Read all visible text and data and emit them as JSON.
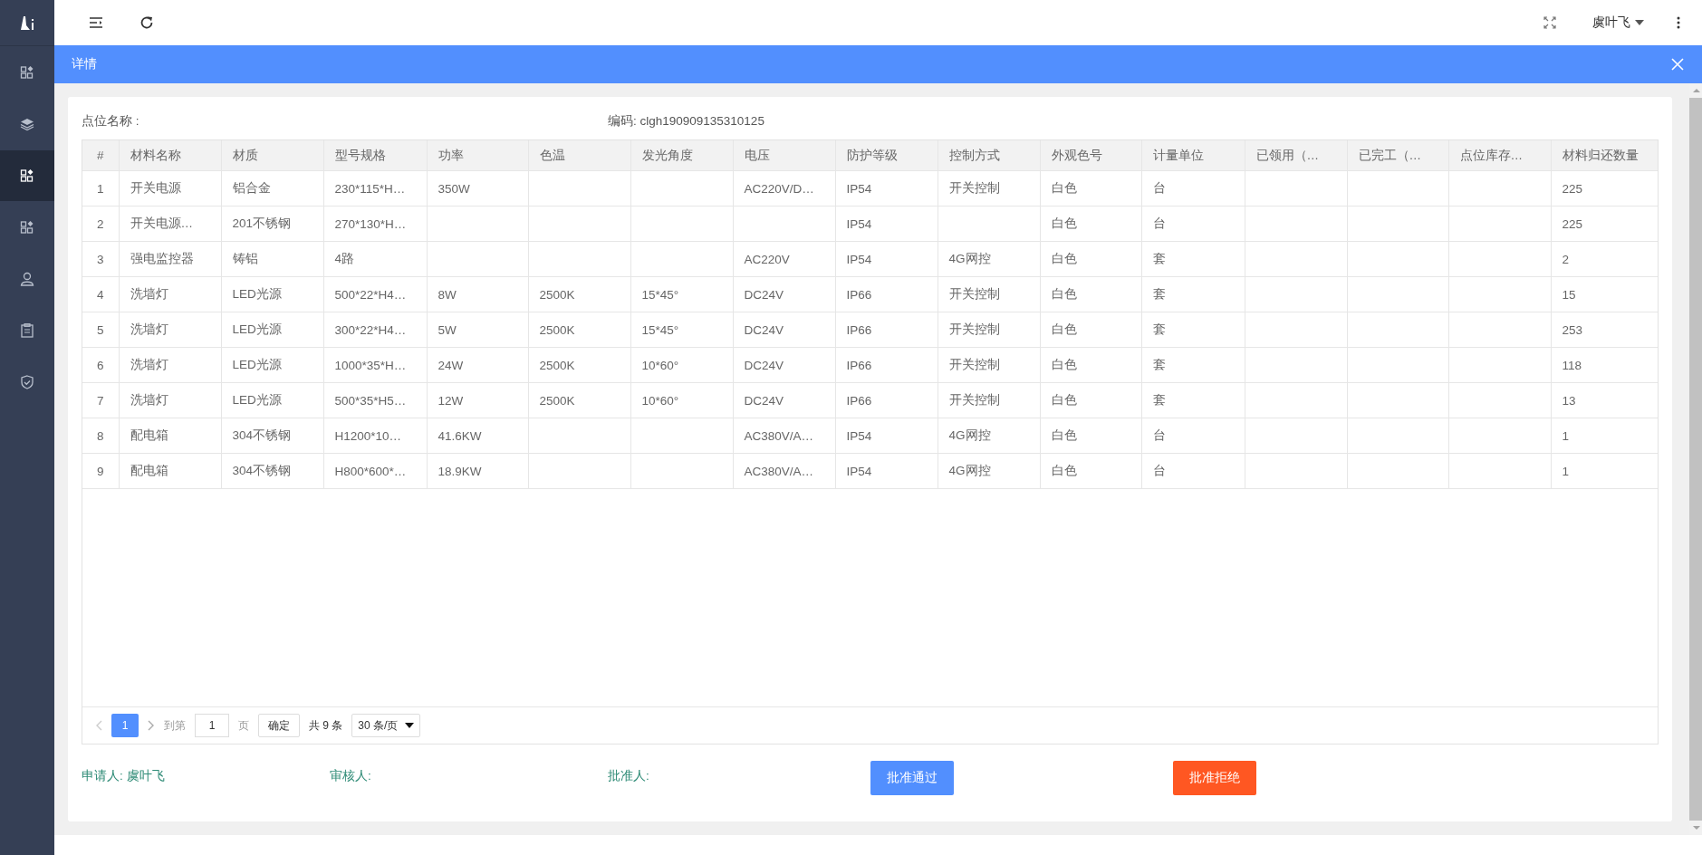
{
  "sidebar": {
    "items": [
      {
        "selected": false
      },
      {
        "selected": false
      },
      {
        "selected": true
      },
      {
        "selected": false
      },
      {
        "selected": false
      },
      {
        "selected": false
      },
      {
        "selected": false
      }
    ]
  },
  "topbar": {
    "user": "虞叶飞"
  },
  "dialog": {
    "title": "详情",
    "point_name_label": "点位名称 :",
    "code": "编码: clgh190909135310125"
  },
  "table": {
    "columns": [
      "#",
      "材料名称",
      "材质",
      "型号规格",
      "功率",
      "色温",
      "发光角度",
      "电压",
      "防护等级",
      "控制方式",
      "外观色号",
      "计量单位",
      "已领用（…",
      "已完工（…",
      "点位库存…",
      "材料归还数量"
    ],
    "rows": [
      [
        "1",
        "开关电源",
        "铝合金",
        "230*115*H…",
        "350W",
        "",
        "",
        "AC220V/D…",
        "IP54",
        "开关控制",
        "白色",
        "台",
        "",
        "",
        "",
        "225"
      ],
      [
        "2",
        "开关电源…",
        "201不锈钢",
        "270*130*H…",
        "",
        "",
        "",
        "",
        "IP54",
        "",
        "白色",
        "台",
        "",
        "",
        "",
        "225"
      ],
      [
        "3",
        "强电监控器",
        "铸铝",
        "4路",
        "",
        "",
        "",
        "AC220V",
        "IP54",
        "4G网控",
        "白色",
        "套",
        "",
        "",
        "",
        "2"
      ],
      [
        "4",
        "洗墙灯",
        "LED光源",
        "500*22*H4…",
        "8W",
        "2500K",
        "15*45°",
        "DC24V",
        "IP66",
        "开关控制",
        "白色",
        "套",
        "",
        "",
        "",
        "15"
      ],
      [
        "5",
        "洗墙灯",
        "LED光源",
        "300*22*H4…",
        "5W",
        "2500K",
        "15*45°",
        "DC24V",
        "IP66",
        "开关控制",
        "白色",
        "套",
        "",
        "",
        "",
        "253"
      ],
      [
        "6",
        "洗墙灯",
        "LED光源",
        "1000*35*H…",
        "24W",
        "2500K",
        "10*60°",
        "DC24V",
        "IP66",
        "开关控制",
        "白色",
        "套",
        "",
        "",
        "",
        "118"
      ],
      [
        "7",
        "洗墙灯",
        "LED光源",
        "500*35*H5…",
        "12W",
        "2500K",
        "10*60°",
        "DC24V",
        "IP66",
        "开关控制",
        "白色",
        "套",
        "",
        "",
        "",
        "13"
      ],
      [
        "8",
        "配电箱",
        "304不锈钢",
        "H1200*10…",
        "41.6KW",
        "",
        "",
        "AC380V/A…",
        "IP54",
        "4G网控",
        "白色",
        "台",
        "",
        "",
        "",
        "1"
      ],
      [
        "9",
        "配电箱",
        "304不锈钢",
        "H800*600*…",
        "18.9KW",
        "",
        "",
        "AC380V/A…",
        "IP54",
        "4G网控",
        "白色",
        "台",
        "",
        "",
        "",
        "1"
      ]
    ]
  },
  "pagination": {
    "pages": [
      {
        "label": "1",
        "selected": true
      }
    ],
    "goto_label": "到第",
    "goto_value": "1",
    "page_unit": "页",
    "confirm": "确定",
    "total": "共 9 条",
    "page_size": "30 条/页"
  },
  "footer": {
    "applicant": "申请人: 虞叶飞",
    "reviewer": "审核人:",
    "approver": "批准人:",
    "approve_button": "批准通过",
    "reject_button": "批准拒绝"
  }
}
